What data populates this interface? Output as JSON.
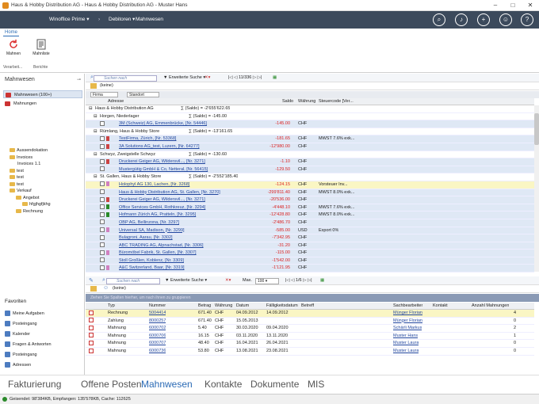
{
  "window": {
    "title": "Haus & Hobby Distribution AG - Haus & Hobby Distribution AG - Muster Hans"
  },
  "nav": {
    "app": "Winoffice Prime",
    "module": "Debitoren",
    "view": "Mahnwesen"
  },
  "ribbon": {
    "tab": "Home",
    "btn1": "Mahnen",
    "btn2": "Mahnliste",
    "grp1": "Verarbeit...",
    "grp2": "Berichte"
  },
  "side": {
    "header": "Mahnwesen",
    "item1": "Mahnwesen (100+)",
    "item2": "Mahnungen",
    "tree": [
      "Aussendokation",
      "Invoices",
      "Invoices 1.1",
      "test",
      "test",
      "test",
      "Verkauf",
      "Angebot",
      "hfgjhgfjkhg",
      "Rechnung"
    ],
    "fav_header": "Favoriten",
    "favs": [
      "Meine Aufgaben",
      "Posteingang",
      "Kalender",
      "Fragen & Antworten",
      "Posteingang",
      "Adressen"
    ]
  },
  "top": {
    "search_placeholder": "Suchen nach",
    "ext": "Erweiterte Suche",
    "pager": "11/336",
    "filter": "(keine)",
    "grp_firma": "Firma",
    "grp_standort": "Standort",
    "cols": {
      "adresse": "Adresse",
      "saldo": "Saldo",
      "waehrung": "Währung",
      "steuer": "Steuercode [Ver..."
    },
    "rows": [
      {
        "t": "g",
        "lvl": 0,
        "name": "Haus & Hobby Distribution AG",
        "sum": "∑ (Saldo) = -2'655'622.65"
      },
      {
        "t": "g",
        "lvl": 1,
        "name": "Horgen, Niederlager",
        "sum": "∑ (Saldo) = -145.00"
      },
      {
        "t": "d",
        "addr": "3M (Schweiz) AG, Emmenbrücke, [Nr. 54446]",
        "saldo": "-145.00",
        "cur": "CHF",
        "st": "",
        "flag": ""
      },
      {
        "t": "g",
        "lvl": 1,
        "name": "Rümlang, Haus & Hobby Store",
        "sum": "∑ (Saldo) = -13'161.65"
      },
      {
        "t": "d",
        "addr": "TestFirma, Zürich, [Nr. 53368]",
        "saldo": "-181.65",
        "cur": "CHF",
        "st": "MWST 7.6% exk...",
        "flag": "#c44"
      },
      {
        "t": "d",
        "addr": "3A Solutions AG_test, Luzern, [Nr. 64277]",
        "saldo": "-12'980.00",
        "cur": "CHF",
        "st": "",
        "flag": "#c44"
      },
      {
        "t": "g",
        "lvl": 1,
        "name": "Schwyz, Zweigstelle Schwyz",
        "sum": "∑ (Saldo) = -130.60"
      },
      {
        "t": "d",
        "addr": "Druckerei Geiger AG, Wildersvil..., [Nr. 3271]",
        "saldo": "-1.10",
        "cur": "CHF",
        "st": "",
        "flag": "#c44"
      },
      {
        "t": "d",
        "addr": "Mustergütig GmbH & Co, Netteral, [Nr. 56415]",
        "saldo": "-129.50",
        "cur": "CHF",
        "st": "",
        "flag": ""
      },
      {
        "t": "g",
        "lvl": 1,
        "name": "St. Gallen, Haus & Hobby Store",
        "sum": "∑ (Saldo) = -2'552'185.40"
      },
      {
        "t": "h",
        "addr": "Holophyl AG 130, Lachen, [Nr. 3268]",
        "saldo": "-124.15",
        "cur": "CHF",
        "st": "Vorsteuer Inv...",
        "flag": "#d080c0"
      },
      {
        "t": "d",
        "addr": "Haus & Hobby Distribution AG, St. Gallen, [Nr. 3270]",
        "saldo": "-299'811.40",
        "cur": "CHF",
        "st": "MWST 8.0% exk...",
        "flag": ""
      },
      {
        "t": "d",
        "addr": "Druckerei Geiger AG, Wildersvil..., [Nr. 3271]",
        "saldo": "-20'536.00",
        "cur": "CHF",
        "st": "",
        "flag": "#c44"
      },
      {
        "t": "d",
        "addr": "Office Services GmbH, Rothkreuz, [Nr. 3294]",
        "saldo": "-4'448.10",
        "cur": "CHF",
        "st": "MWST 7.6% exk...",
        "flag": "#2a8a2a"
      },
      {
        "t": "d",
        "addr": "Hofmann Zürich AG, Pratteln, [Nr. 3295]",
        "saldo": "-12'428.80",
        "cur": "CHF",
        "st": "MWST 8.0% exk...",
        "flag": "#2a8a2a"
      },
      {
        "t": "d",
        "addr": "OBP AG, Bellinzona, [Nr. 3297]",
        "saldo": "-2'486.70",
        "cur": "CHF",
        "st": "",
        "flag": ""
      },
      {
        "t": "d",
        "addr": "Universal SA, Madison, [Nr. 3299]",
        "saldo": "-585.00",
        "cur": "USD",
        "st": "Export 0%",
        "flag": "#d080c0"
      },
      {
        "t": "d",
        "addr": "Bulagroni, Aarau, [Nr. 3302]",
        "saldo": "-7'342.95",
        "cur": "CHF",
        "st": "",
        "flag": ""
      },
      {
        "t": "d",
        "addr": "ABC TRADING AG, Alpnachstad, [Nr. 3306]",
        "saldo": "-31.20",
        "cur": "CHF",
        "st": "",
        "flag": ""
      },
      {
        "t": "d",
        "addr": "Büromöbel Fabrik, St. Gallen, [Nr. 3307]",
        "saldo": "-115.00",
        "cur": "CHF",
        "st": "",
        "flag": "#d080c0"
      },
      {
        "t": "d",
        "addr": "Stoll Großlen, Koblenz, [Nr. 3309]",
        "saldo": "-1'542.00",
        "cur": "CHF",
        "st": "",
        "flag": ""
      },
      {
        "t": "d",
        "addr": "A&C Switzerland, Baar, [Nr. 3319]",
        "saldo": "-1'121.95",
        "cur": "CHF",
        "st": "",
        "flag": "#d080c0"
      }
    ]
  },
  "bot": {
    "search_placeholder": "Suchen nach",
    "ext": "Erweiterte Suche",
    "max_label": "Max.",
    "max_val": "100",
    "pager": "1/6",
    "filter": "(keine)",
    "group_hint": "Ziehen Sie Spalten hierher, um nach ihnen zu gruppieren",
    "cols": {
      "typ": "Typ",
      "nummer": "Nummer",
      "betrag": "Betrag",
      "waehrung": "Währung",
      "datum": "Datum",
      "faellig": "Fälligkeitsdatum",
      "betreff": "Betreff",
      "sb": "Sachbearbeiter",
      "kontakt": "Kontakt",
      "anzahl": "Anzahl Mahnungen"
    },
    "rows": [
      {
        "typ": "Rechnung",
        "nr": "5004414",
        "betrag": "671.40",
        "cur": "CHF",
        "datum": "04.09.2012",
        "faellig": "14.09.2012",
        "sb": "Münger Florian",
        "anz": "4",
        "hl": true
      },
      {
        "typ": "Zahlung",
        "nr": "8000257",
        "betrag": "671.40",
        "cur": "CHF",
        "datum": "15.05.2013",
        "faellig": "",
        "sb": "Münger Florian",
        "anz": "0",
        "hl": false
      },
      {
        "typ": "Mahnung",
        "nr": "6000702",
        "betrag": "5.40",
        "cur": "CHF",
        "datum": "30.03.2020",
        "faellig": "09.04.2020",
        "sb": "Schärli Markus",
        "anz": "2",
        "hl": false
      },
      {
        "typ": "Mahnung",
        "nr": "6000706",
        "betrag": "16.15",
        "cur": "CHF",
        "datum": "03.11.2020",
        "faellig": "13.11.2020",
        "sb": "Muster Hans",
        "anz": "1",
        "hl": false
      },
      {
        "typ": "Mahnung",
        "nr": "6000707",
        "betrag": "48.40",
        "cur": "CHF",
        "datum": "16.04.2021",
        "faellig": "26.04.2021",
        "sb": "Muster Laura",
        "anz": "0",
        "hl": false
      },
      {
        "typ": "Mahnung",
        "nr": "6000736",
        "betrag": "53.80",
        "cur": "CHF",
        "datum": "13.08.2021",
        "faellig": "23.08.2021",
        "sb": "Muster Laura",
        "anz": "0",
        "hl": false
      }
    ]
  },
  "tabs": [
    "Fakturierung",
    "Offene Posten",
    "Mahnwesen",
    "Kontakte",
    "Dokumente",
    "MIS"
  ],
  "active_tab": "Mahnwesen",
  "status": "Geisendet: 98'384KB, Empfangen: 135'578KB, Cache: 112625"
}
